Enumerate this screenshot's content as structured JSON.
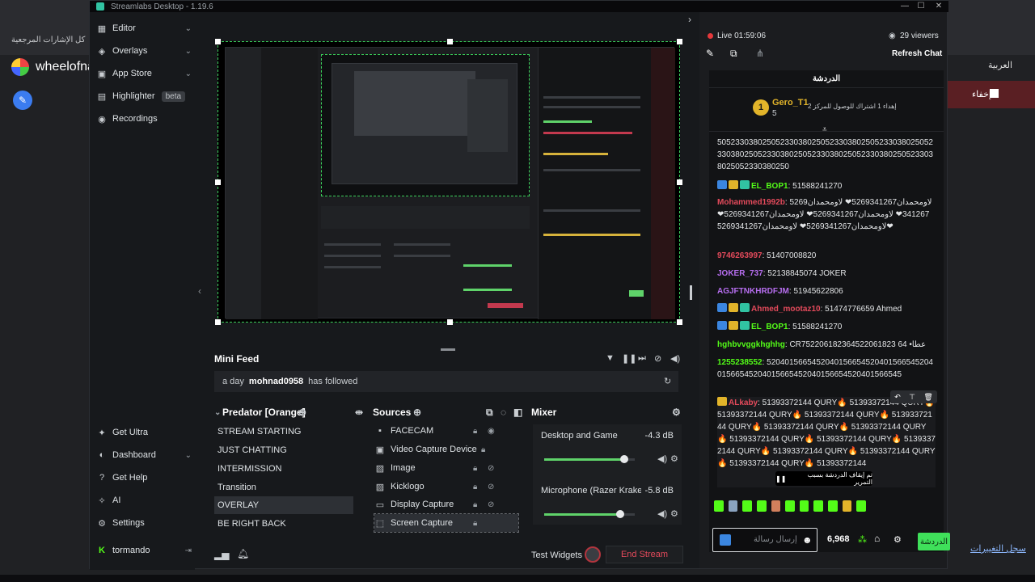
{
  "browser": {
    "bookmark_label": "كل الإشارات المرجعية",
    "site_title": "wheelofna",
    "right_label": "إخفاء",
    "right_link": "سجل التغييرات",
    "right_tab": "العربية"
  },
  "window": {
    "title": "Streamlabs Desktop - 1.19.6",
    "min": "—",
    "max": "☐",
    "close": "✕"
  },
  "sidebar": {
    "top": [
      {
        "label": "Editor"
      },
      {
        "label": "Overlays"
      },
      {
        "label": "App Store"
      },
      {
        "label": "Highlighter",
        "badge": "beta"
      },
      {
        "label": "Recordings"
      }
    ],
    "bottom": [
      {
        "label": "Get Ultra"
      },
      {
        "label": "Dashboard"
      },
      {
        "label": "Get Help"
      },
      {
        "label": "AI"
      },
      {
        "label": "Settings"
      },
      {
        "label": "tormando"
      }
    ]
  },
  "minifeed": {
    "title": "Mini Feed",
    "event_time": "a day",
    "event_user": "mohnad0958",
    "event_action": "has followed"
  },
  "scenes": {
    "title": "Predator [Orange]",
    "items": [
      "STREAM STARTING",
      "JUST CHATTING",
      "INTERMISSION",
      "Transition",
      "OVERLAY",
      "BE RIGHT BACK"
    ],
    "selected_index": 4
  },
  "sources": {
    "title": "Sources",
    "items": [
      "FACECAM",
      "Video Capture Device",
      "Image",
      "Kicklogo",
      "Display Capture",
      "Screen Capture"
    ],
    "selected_index": 5
  },
  "mixer": {
    "title": "Mixer",
    "channels": [
      {
        "name": "Desktop and Game",
        "db": "-4.3 dB",
        "level": 0.88
      },
      {
        "name": "Microphone (Razer Kraken ...",
        "db": "-5.8 dB",
        "level": 0.84
      }
    ]
  },
  "footer": {
    "test_widgets": "Test Widgets",
    "end_stream": "End Stream"
  },
  "live": {
    "status": "Live 01:59:06",
    "viewers": "29 viewers",
    "refresh": "Refresh Chat"
  },
  "chat": {
    "title": "الدردشة",
    "pinned_user": "Gero_T1",
    "pinned_rank": "5",
    "pinned_text": "إهداء 1 اشتراك للوصول للمركز 2",
    "messages": [
      {
        "user": "",
        "text": "5052330380250523303802505233038025052330380250523303802505233038025052330380250523303802505233038025052330380250"
      },
      {
        "user": "EL_BOP1",
        "text": ": 51588241270"
      },
      {
        "user": "Mohammed1992b",
        "text": ": لاومحمدان5269341267❤ لاومحمدان5269341267❤ لاومحمدان5269341267❤ لاومحمدان5269341267❤ لاومحمدان5269341267❤ لاومحمدان5269341267❤"
      },
      {
        "user": "9746263997",
        "text": ": 51407008820"
      },
      {
        "user": "JOKER_737",
        "text": ": 52138845074 JOKER"
      },
      {
        "user": "AGJFTNKHRDFJM",
        "text": ": 51945622806"
      },
      {
        "user": "Ahmed_mootaz10",
        "text": ": 51474776659 Ahmed"
      },
      {
        "user": "EL_BOP1",
        "text": ": 51588241270"
      },
      {
        "user": "hghbvvggkhghhg",
        "text": ": CR752206182364522061823 64 •عطا"
      },
      {
        "user": "1255238552",
        "text": ": 520401566545204015665452040156654520401566545204015665452040156654520401566545"
      },
      {
        "user": "ALkaby",
        "text": ": 51393372144 QURY🔥 51393372144 QURY🔥 51393372144 QURY🔥 51393372144 QURY🔥 51393372144 QURY🔥 51393372144 QURY🔥 51393372144 QURY🔥 51393372144 QURY🔥 51393372144 QURY🔥 51393372144 QURY🔥 51393372144 QURY🔥 51393372144 QURY🔥 51393372144 QURY🔥 51393372144"
      }
    ],
    "paused_notice": "تم إيقاف الدردشة بسبب التمرير",
    "input_placeholder": "إرسال رسالة",
    "points": "6,968",
    "send_label": "الدردشة"
  }
}
